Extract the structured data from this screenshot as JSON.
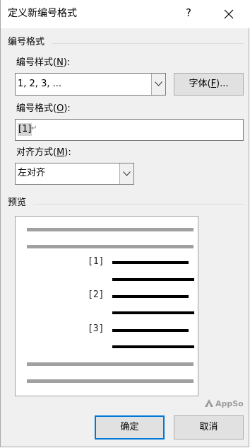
{
  "dialog": {
    "title": "定义新编号格式",
    "help_glyph": "?",
    "close_icon": "close-icon"
  },
  "format_group": {
    "heading": "编号格式",
    "style_label_prefix": "编号样式(",
    "style_label_key": "N",
    "style_label_suffix": "):",
    "style_value": "1, 2, 3, ...",
    "font_button_prefix": "字体(",
    "font_button_key": "F",
    "font_button_suffix": ")...",
    "format_label_prefix": "编号格式(",
    "format_label_key": "O",
    "format_label_suffix": "):",
    "format_value": "[1]",
    "format_mark": "↵",
    "align_label_prefix": "对齐方式(",
    "align_label_key": "M",
    "align_label_suffix": "):",
    "align_value": "左对齐"
  },
  "preview_group": {
    "heading": "预览",
    "numbers": [
      "[1]",
      "[2]",
      "[3]"
    ]
  },
  "buttons": {
    "ok": "确定",
    "cancel": "取消"
  },
  "watermark": {
    "text": "AppSo",
    "icon": "appso-logo-icon"
  },
  "colors": {
    "accent": "#0078d7",
    "dialog_bg": "#f0f0f0",
    "preview_gray": "#a0a0a0"
  }
}
